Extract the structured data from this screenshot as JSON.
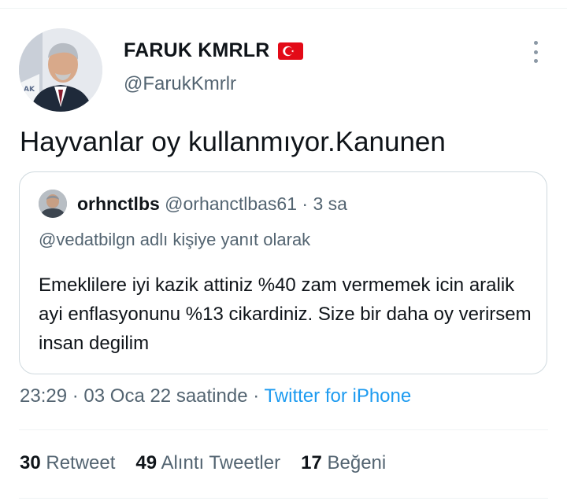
{
  "author": {
    "display_name": "FARUK KMRLR",
    "handle": "@FarukKmrlr",
    "flag_icon": "turkey-flag-icon"
  },
  "tweet": {
    "text": "Hayvanlar oy kullanmıyor.Kanunen"
  },
  "quoted_tweet": {
    "display_name": "orhnctlbs",
    "handle": "@orhanctlbas61",
    "separator": "·",
    "time_ago": "3 sa",
    "replying_to": "@vedatbilgn adlı kişiye yanıt olarak",
    "text": "Emeklilere iyi kazik attiniz %40 zam vermemek icin aralik ayi enflasyonunu %13 cikardiniz. Size bir daha oy verirsem insan degilim"
  },
  "meta": {
    "time": "23:29",
    "sep1": "·",
    "date": "03 Oca 22 saatinde",
    "sep2": "·",
    "source": "Twitter for iPhone"
  },
  "stats": {
    "retweets_count": "30",
    "retweets_label": "Retweet",
    "quotes_count": "49",
    "quotes_label": "Alıntı Tweetler",
    "likes_count": "17",
    "likes_label": "Beğeni"
  },
  "colors": {
    "secondary_text": "#536471",
    "link": "#1d9bf0",
    "border": "#cfd9de",
    "divider": "#eff3f4"
  }
}
